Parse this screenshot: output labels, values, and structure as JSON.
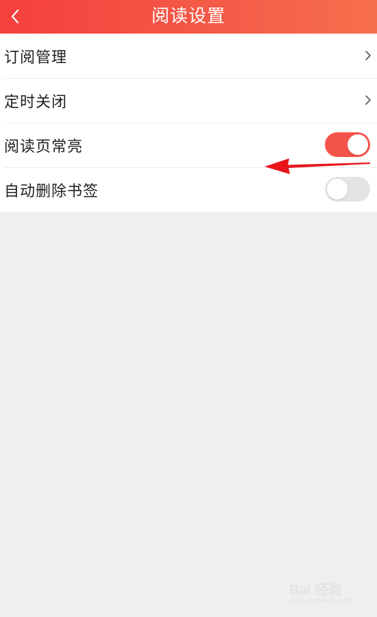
{
  "header": {
    "title": "阅读设置",
    "back_icon": "chevron-left-icon",
    "background_color": "#f54a42"
  },
  "settings": {
    "items": [
      {
        "label": "订阅管理",
        "type": "link",
        "icon": "chevron-right-icon"
      },
      {
        "label": "定时关闭",
        "type": "link",
        "icon": "chevron-right-icon"
      },
      {
        "label": "阅读页常亮",
        "type": "toggle",
        "checked": true
      },
      {
        "label": "自动删除书签",
        "type": "toggle",
        "checked": false
      }
    ]
  },
  "annotation": {
    "icon": "red-arrow-pointer",
    "color": "#e8161b"
  },
  "watermark": {
    "brand": "Bai 经验",
    "url": "jingyan.baidu.com"
  },
  "colors": {
    "toggle_on": "#f5544a",
    "toggle_off": "#e4e4e4",
    "page_background": "#efefef"
  }
}
